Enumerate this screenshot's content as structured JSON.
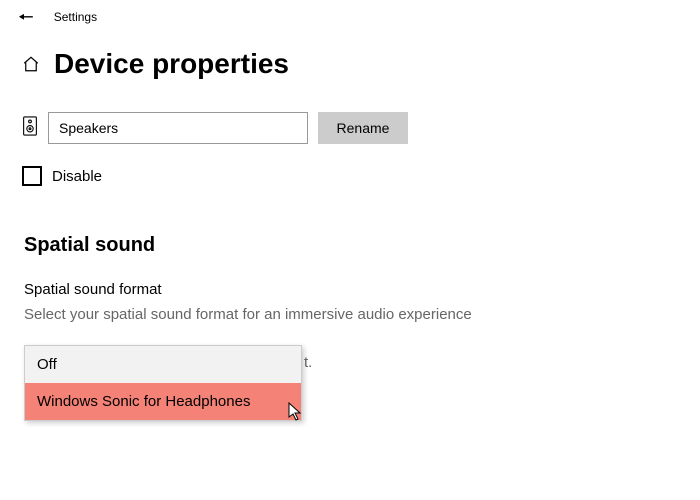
{
  "topbar": {
    "settings": "Settings"
  },
  "header": {
    "title": "Device properties"
  },
  "device": {
    "name": "Speakers",
    "rename": "Rename"
  },
  "disable": {
    "label": "Disable"
  },
  "spatial": {
    "section_title": "Spatial sound",
    "field_label": "Spatial sound format",
    "helper_visible": "Select your spatial sound format for an immersive audio experience",
    "helper_tail": "t.",
    "options": {
      "off": "Off",
      "sonic": "Windows Sonic for Headphones"
    }
  }
}
